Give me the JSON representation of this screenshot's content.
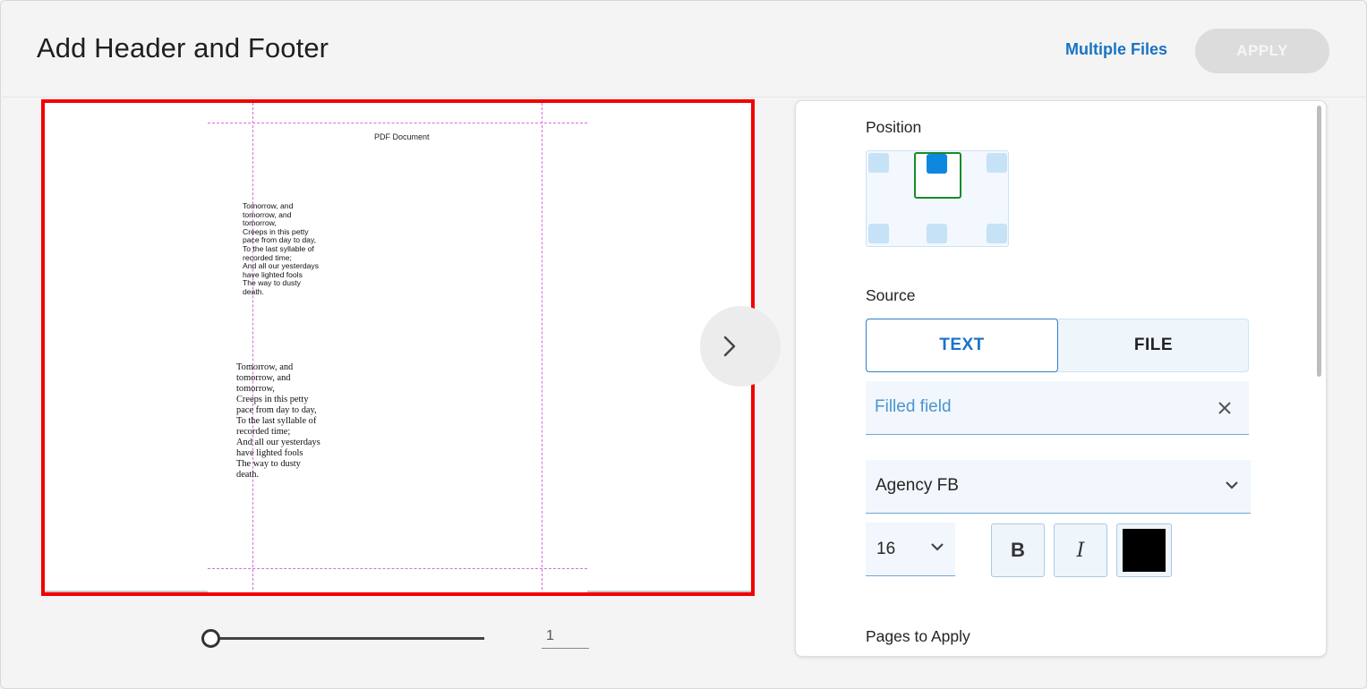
{
  "header": {
    "title": "Add Header and Footer",
    "multiple_files_label": "Multiple Files",
    "apply_label": "APPLY"
  },
  "preview": {
    "header_text": "PDF Document",
    "poem_lines_small": [
      "Tomorrow, and",
      "tomorrow, and",
      "tomorrow,",
      "Creeps in this petty",
      "pace from day to day,",
      "To the last syllable of",
      "recorded time;",
      "And all our yesterdays",
      "have lighted fools",
      "The way to dusty",
      "death."
    ],
    "poem_lines_large": [
      "Tomorrow, and",
      "tomorrow, and",
      "tomorrow,",
      "Creeps in this petty",
      "pace from day to day,",
      "To the last syllable of",
      "recorded time;",
      "And all our yesterdays",
      "have lighted fools",
      "The way to dusty",
      "death."
    ],
    "next_icon": "chevron-right-icon"
  },
  "pager": {
    "page_number": "1",
    "slider_value": 0
  },
  "settings": {
    "position_label": "Position",
    "position_selected": "top-center",
    "source_label": "Source",
    "source_tabs": [
      "TEXT",
      "FILE"
    ],
    "source_selected": "TEXT",
    "text_value": "Filled field",
    "font_family": "Agency FB",
    "font_size": "16",
    "bold_label": "B",
    "italic_label": "I",
    "text_color": "#000000",
    "pages_to_apply_label": "Pages to Apply"
  },
  "colors": {
    "accent": "#1a73c4",
    "highlight_border": "#f20000",
    "guide": "#d86ae0"
  }
}
